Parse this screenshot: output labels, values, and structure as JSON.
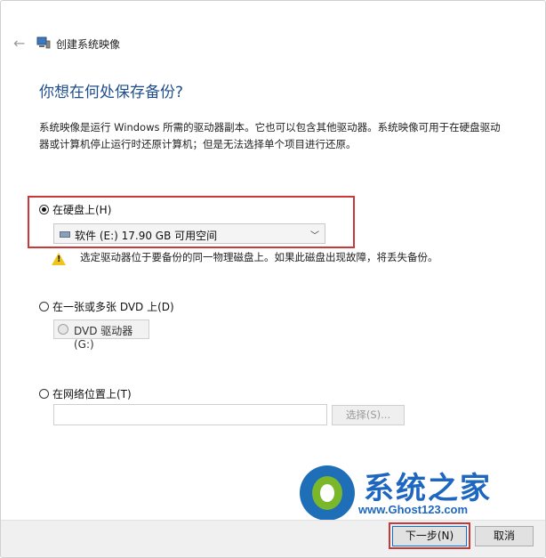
{
  "window": {
    "title": "创建系统映像"
  },
  "heading": "你想在何处保存备份?",
  "description": "系统映像是运行 Windows 所需的驱动器副本。它也可以包含其他驱动器。系统映像可用于在硬盘驱动器或计算机停止运行时还原计算机；但是无法选择单个项目进行还原。",
  "options": {
    "hard_disk": {
      "label": "在硬盘上(H)",
      "selected": true,
      "dropdown_value": "软件 (E:)  17.90 GB 可用空间",
      "warning": "选定驱动器位于要备份的同一物理磁盘上。如果此磁盘出现故障，将丢失备份。"
    },
    "dvd": {
      "label": "在一张或多张 DVD 上(D)",
      "selected": false,
      "drive_value": "DVD 驱动器 (G:)"
    },
    "network": {
      "label": "在网络位置上(T)",
      "selected": false,
      "path_value": "",
      "browse_label": "选择(S)..."
    }
  },
  "watermark": {
    "text": "系统之家",
    "url": "www.Ghost123.com"
  },
  "footer": {
    "next_label": "下一步(N)",
    "cancel_label": "取消"
  },
  "colors": {
    "heading": "#1f4e8c",
    "highlight": "#c83a3a",
    "logo": "#1e67c0"
  }
}
